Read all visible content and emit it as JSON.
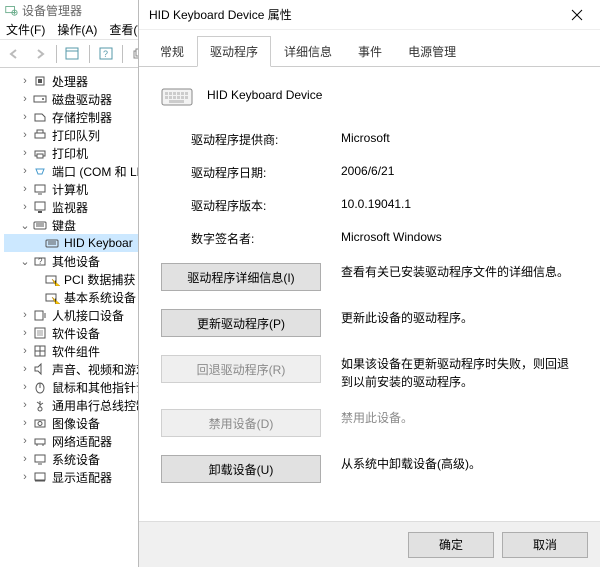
{
  "device_manager": {
    "title": "设备管理器",
    "menu": {
      "file": "文件(F)",
      "action": "操作(A)",
      "view": "查看(V"
    },
    "tree": {
      "processors": "处理器",
      "disk_drives": "磁盘驱动器",
      "storage_controllers": "存储控制器",
      "print_queues": "打印队列",
      "printers": "打印机",
      "ports": "端口 (COM 和 LP",
      "computer": "计算机",
      "monitors": "监视器",
      "keyboards": "键盘",
      "hid_keyboard_device": "HID Keyboar",
      "other_devices": "其他设备",
      "pci_data_acq": "PCI 数据捕获",
      "base_system_device": "基本系统设备",
      "hid": "人机接口设备",
      "software_devices": "软件设备",
      "software_components": "软件组件",
      "sound_video_game": "声音、视频和游戏",
      "mice": "鼠标和其他指针设",
      "usb_controllers": "通用串行总线控制",
      "imaging_devices": "图像设备",
      "network_adapters": "网络适配器",
      "system_devices": "系统设备",
      "display_adapters": "显示适配器"
    }
  },
  "dialog": {
    "title": "HID Keyboard Device 属性",
    "tabs": {
      "general": "常规",
      "driver": "驱动程序",
      "details": "详细信息",
      "events": "事件",
      "power": "电源管理"
    },
    "device_name": "HID Keyboard Device",
    "props": {
      "provider_label": "驱动程序提供商:",
      "provider_value": "Microsoft",
      "date_label": "驱动程序日期:",
      "date_value": "2006/6/21",
      "version_label": "驱动程序版本:",
      "version_value": "10.0.19041.1",
      "signer_label": "数字签名者:",
      "signer_value": "Microsoft Windows"
    },
    "actions": {
      "details": {
        "label": "驱动程序详细信息(I)",
        "desc": "查看有关已安装驱动程序文件的详细信息。"
      },
      "update": {
        "label": "更新驱动程序(P)",
        "desc": "更新此设备的驱动程序。"
      },
      "rollback": {
        "label": "回退驱动程序(R)",
        "desc": "如果该设备在更新驱动程序时失败，则回退到以前安装的驱动程序。"
      },
      "disable": {
        "label": "禁用设备(D)",
        "desc": "禁用此设备。"
      },
      "uninstall": {
        "label": "卸载设备(U)",
        "desc": "从系统中卸载设备(高级)。"
      }
    },
    "footer": {
      "ok": "确定",
      "cancel": "取消"
    }
  }
}
